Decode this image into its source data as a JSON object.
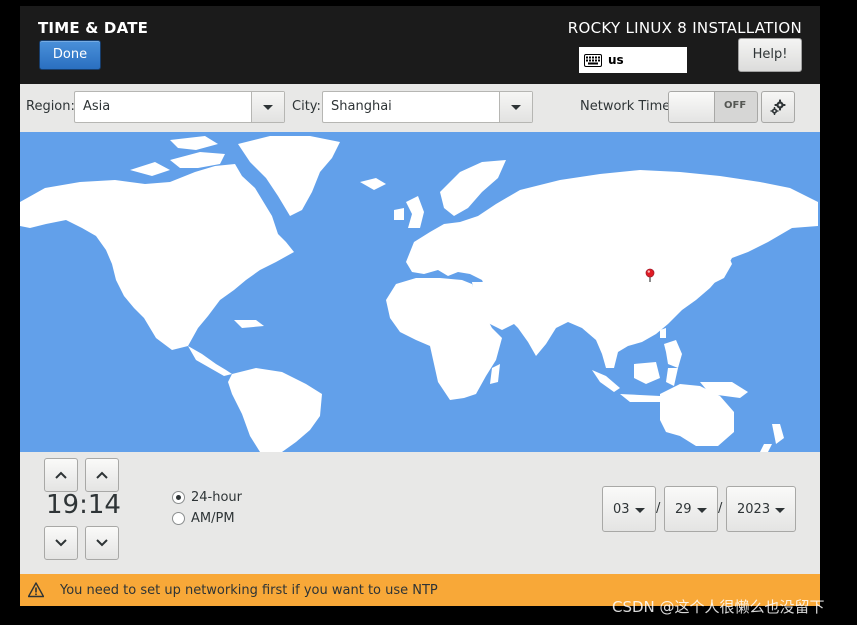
{
  "header": {
    "screen_title": "TIME & DATE",
    "product_title": "ROCKY LINUX 8 INSTALLATION",
    "done_label": "Done",
    "keyboard_layout": "us",
    "help_label": "Help!"
  },
  "toolbar": {
    "region_label": "Region:",
    "region_value": "Asia",
    "city_label": "City:",
    "city_value": "Shanghai",
    "network_time_label": "Network Time",
    "network_time_state": "OFF"
  },
  "time": {
    "display": "19:14",
    "format_options": [
      "24-hour",
      "AM/PM"
    ],
    "selected_format": "24-hour"
  },
  "date": {
    "month": "03",
    "day": "29",
    "year": "2023",
    "separator": "/"
  },
  "warning": {
    "text": "You need to set up networking first if you want to use NTP"
  },
  "colors": {
    "ocean": "#62a0ea",
    "land": "#ffffff",
    "accent": "#2a6fc0",
    "warning": "#f8a838",
    "header_bg": "#1b1b1b",
    "marker": "#e01b24"
  },
  "watermark": "CSDN @这个人很懒么也没留下"
}
